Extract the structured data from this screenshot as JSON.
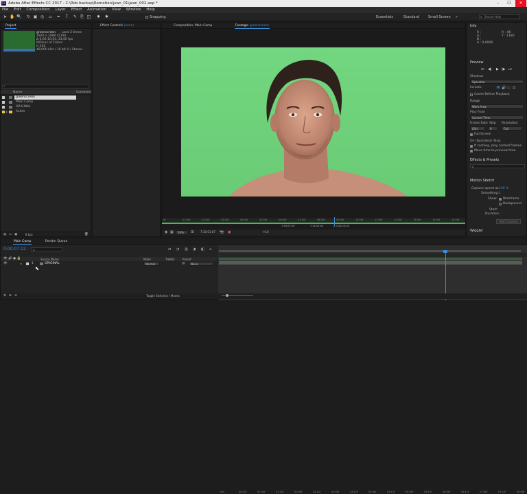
{
  "title_bar": {
    "logo": "Ae",
    "text": "Adobe After Effects CC 2017 - C:\\Rob backup\\Romotion\\jean_01\\jean_002.aep *",
    "minimize": "–",
    "maximize": "☐",
    "close": "✕"
  },
  "menu": [
    "File",
    "Edit",
    "Composition",
    "Layer",
    "Effect",
    "Animation",
    "View",
    "Window",
    "Help"
  ],
  "toolbar": {
    "tools": [
      "selection-tool",
      "hand-tool",
      "zoom-tool",
      "rotate-tool",
      "camera-tool",
      "pan-behind-tool",
      "rectangle-tool",
      "pen-tool",
      "type-tool",
      "brush-tool",
      "clone-stamp-tool",
      "eraser-tool",
      "roto-brush-tool",
      "puppet-tool"
    ],
    "tool_glyphs": [
      "➤",
      "✋",
      "🔍",
      "↻",
      "▣",
      "◎",
      "▭",
      "✒",
      "T",
      "✎",
      "⎘",
      "◫",
      "✸",
      "✱"
    ],
    "snapping_label": "Snapping",
    "workspaces": [
      "Essentials",
      "Standard",
      "Small Screen"
    ],
    "search_placeholder": "Search Help"
  },
  "project_panel": {
    "tab": "Project",
    "footage_name": "greenscreen",
    "footage_used": ", used 2 times",
    "footage_info": [
      "1920 x 1080 (1,00)",
      "Δ 0;00;10;04, 24,00 fps",
      "Millions of Colors",
      "H.264",
      "48,000 kHz / 16 bit U / Stereo"
    ],
    "search_placeholder": "",
    "col_name": "Name",
    "col_comment": "Comment",
    "items": [
      {
        "name": "greenscreen",
        "color": "#c9c9c9",
        "selected": true
      },
      {
        "name": "Main Comp",
        "color": "#c9c9c9",
        "selected": false
      },
      {
        "name": "ORIGINAL",
        "color": "#c9c9c9",
        "selected": false
      },
      {
        "name": "Solids",
        "color": "#e5c54a",
        "selected": false
      }
    ],
    "bpc": "8 bpc"
  },
  "effect_controls": {
    "tab_prefix": "Effect Controls",
    "tab_value": "(none)"
  },
  "viewer": {
    "tab_comp": "Composition: Main Comp",
    "tab_footage_prefix": "Footage:",
    "tab_footage_name": "greenscreen",
    "ruler_labels": [
      "0f",
      "01:00f",
      "02:00f",
      "03:00f",
      "04:00f",
      "05:00f",
      "06:00f",
      "07:00f",
      "08:00f",
      "09:00f",
      "10:00f",
      "11:00f",
      "12:00f",
      "13:00f",
      "14:00f",
      "15:00f"
    ],
    "ruler_start": "00f",
    "in_point": "0:00:00:00",
    "out_point": "7:29:00:00",
    "duration": "Δ 3:40:03:09",
    "playhead": "7:30:07:09",
    "zoom": "50%",
    "current_time": "7:30:01:07",
    "plus_value": "+0,0",
    "edit_target": "Edit Target: Main Comp",
    "ruler_mid": [
      "7:30:07:09",
      "7:31:02:04",
      "Δ 0:00:24:18"
    ],
    "green_color": "#71d67e"
  },
  "info_panel": {
    "tab": "Info",
    "r": "R :",
    "g": "G :",
    "b": "B :",
    "a": "A : 0,0000",
    "x": "X : 46",
    "y": "Y : 1180"
  },
  "preview_panel": {
    "tab": "Preview",
    "shortcut_label": "Shortcut",
    "shortcut_value": "Spacebar",
    "include_label": "Include:",
    "cache_label": "Cache Before Playback",
    "range_label": "Range",
    "range_value": "Work Area",
    "play_from_label": "Play From",
    "play_from_value": "Current Time",
    "frame_rate_label": "Frame Rate",
    "skip_label": "Skip",
    "resolution_label": "Resolution",
    "frame_rate_value": "(24)",
    "skip_value": "0",
    "resolution_value": "Full",
    "full_screen_label": "Full Screen",
    "on_stop_label": "On (Spacebar) Stop:",
    "if_caching_label": "If caching, play cached frames",
    "move_time_label": "Move time to preview time"
  },
  "effects_presets": {
    "tab": "Effects & Presets",
    "search_placeholder": "ρ"
  },
  "motion_sketch": {
    "tab": "Motion Sketch",
    "capture_speed_label": "Capture speed at:",
    "capture_speed_value": "100 %",
    "smoothing_label": "Smoothing:",
    "smoothing_value": "1",
    "show_label": "Show:",
    "wireframe_label": "Wireframe",
    "background_label": "Background",
    "start_label": "Start:",
    "duration_label": "Duration:",
    "start_capture": "Start Capture"
  },
  "wiggler": {
    "tab": "Wiggler"
  },
  "timeline": {
    "tab_main": "Main Comp",
    "tab_render": "Render Queue",
    "timecode": "0:00:07:12",
    "search_placeholder": "ρ",
    "col_source": "Source Name",
    "col_mode": "Mode",
    "col_trkmat": "TrkMat",
    "col_parent": "Parent",
    "layer_num": "1",
    "layer_name": "ORIGINAL",
    "layer_mode": "Normal",
    "layer_parent": "None",
    "ruler_labels": [
      "00f",
      "00:12f",
      "01:00f",
      "01:12f",
      "02:00f",
      "02:12f",
      "03:00f",
      "03:12f",
      "04:00f",
      "04:12f",
      "05:00f",
      "05:12f",
      "06:00f",
      "06:12f",
      "07:00f",
      "07:12f",
      "08:00f"
    ],
    "toggle_label": "Toggle Switches / Modes"
  }
}
